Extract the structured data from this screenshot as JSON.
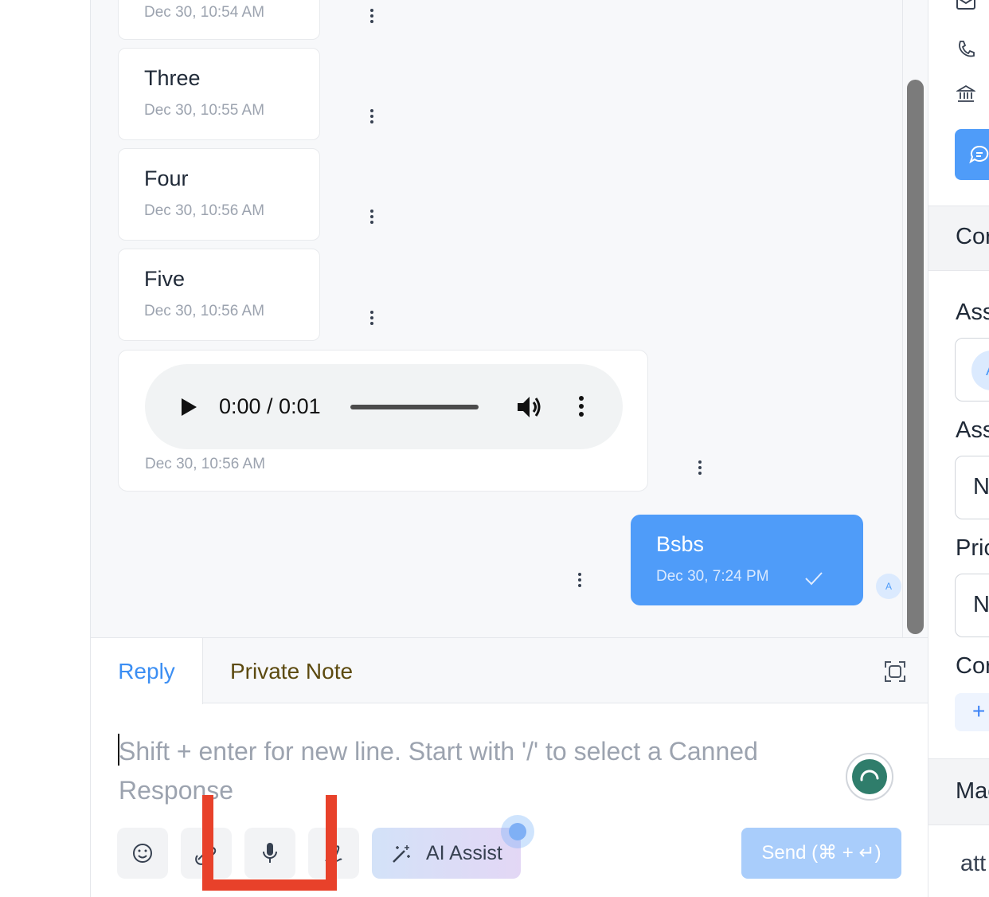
{
  "messages": [
    {
      "text": "",
      "time": "Dec 30, 10:54 AM"
    },
    {
      "text": "Three",
      "time": "Dec 30, 10:55 AM"
    },
    {
      "text": "Four",
      "time": "Dec 30, 10:56 AM"
    },
    {
      "text": "Five",
      "time": "Dec 30, 10:56 AM"
    }
  ],
  "audio": {
    "time": "0:00 / 0:01",
    "timestamp": "Dec 30, 10:56 AM",
    "progress": 0
  },
  "outgoing": {
    "text": "Bsbs",
    "time": "Dec 30, 7:24 PM",
    "avatar": "A",
    "status": "sent"
  },
  "editor": {
    "tabs": [
      {
        "label": "Reply",
        "active": true
      },
      {
        "label": "Private Note",
        "active": false
      }
    ],
    "placeholder": "Shift + enter for new line. Start with '/' to select a Canned Response",
    "ai_assist": "AI Assist",
    "send": "Send (⌘ + ↵)"
  },
  "right_panel": {
    "icons": [
      "mail-icon",
      "phone-icon",
      "bank-icon",
      "chat-icon"
    ],
    "section_title": "Cor",
    "labels": [
      "Ass",
      "Ass",
      "Pric",
      "Cor"
    ],
    "values": [
      "A",
      "N",
      "N"
    ],
    "macros_title": "Mac",
    "bottom_text": "att"
  },
  "colors": {
    "accent": "#4f9cf9",
    "private_note": "#5c4a0f",
    "annotation": "#e8412a"
  }
}
